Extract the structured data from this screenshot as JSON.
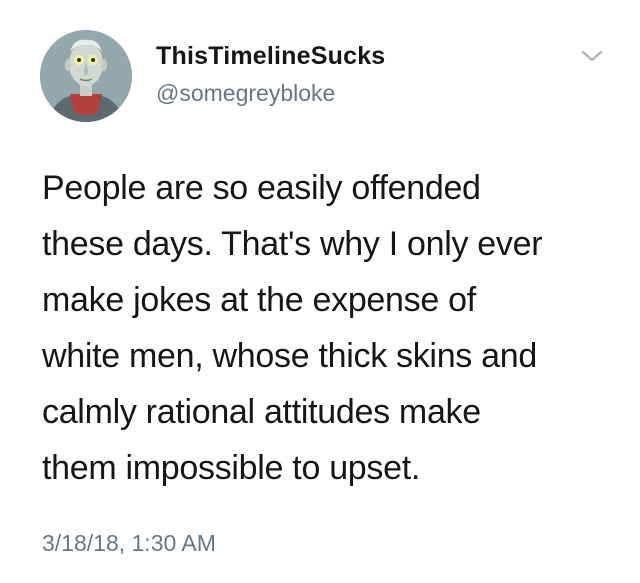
{
  "author": {
    "display_name": "ThisTimelineSucks",
    "handle": "@somegreybloke",
    "avatar_icon": "cartoon-grey-man-avatar"
  },
  "menu": {
    "icon": "chevron-down-icon"
  },
  "tweet": {
    "lines": [
      "People are so easily offended",
      "these days. That's why I only ever",
      "make jokes at the expense of",
      "white men, whose thick skins and",
      "calmly rational attitudes make",
      "them impossible to upset."
    ],
    "timestamp": "3/18/18, 1:30 AM"
  },
  "colors": {
    "text_primary": "#14171a",
    "text_secondary": "#657786",
    "caret": "#aab8c2",
    "background": "#ffffff"
  }
}
